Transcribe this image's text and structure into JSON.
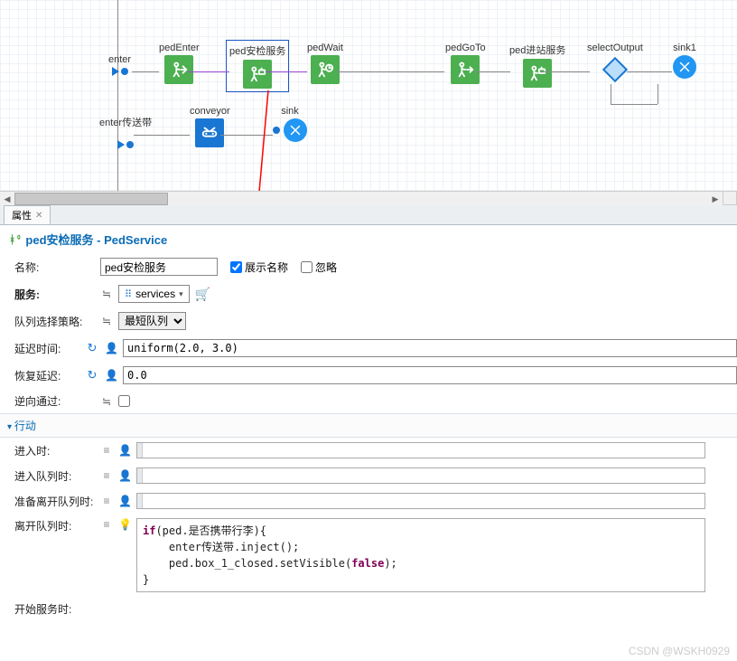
{
  "canvas": {
    "blocks": {
      "enter": "enter",
      "pedEnter": "pedEnter",
      "pedSecurity": "ped安检服务",
      "pedWait": "pedWait",
      "pedGoTo": "pedGoTo",
      "pedStation": "ped进站服务",
      "selectOutput": "selectOutput",
      "sink1": "sink1",
      "enterConveyor": "enter传送带",
      "conveyor": "conveyor",
      "sink": "sink"
    }
  },
  "tab": {
    "title": "属性"
  },
  "header": {
    "title": "ped安检服务 - PedService"
  },
  "form": {
    "name_label": "名称:",
    "name_value": "ped安检服务",
    "show_name_label": "展示名称",
    "ignore_label": "忽略",
    "service_label": "服务:",
    "service_collection": "services",
    "queue_label": "队列选择策略:",
    "queue_value": "最短队列",
    "delay_label": "延迟时间:",
    "delay_expr": "uniform(2.0, 3.0)",
    "recover_label": "恢复延迟:",
    "recover_expr": "0.0",
    "reverse_label": "逆向通过:"
  },
  "actions": {
    "section": "行动",
    "on_enter": "进入时:",
    "on_queue_enter": "进入队列时:",
    "on_ready_leave": "准备离开队列时:",
    "on_leave_queue": "离开队列时:",
    "on_start_service": "开始服务时:",
    "code_lines": [
      "if(ped.是否携带行李){",
      "    enter传送带.inject();",
      "    ped.box_1_closed.setVisible(false);",
      "}"
    ]
  },
  "watermark": "CSDN @WSKH0929"
}
